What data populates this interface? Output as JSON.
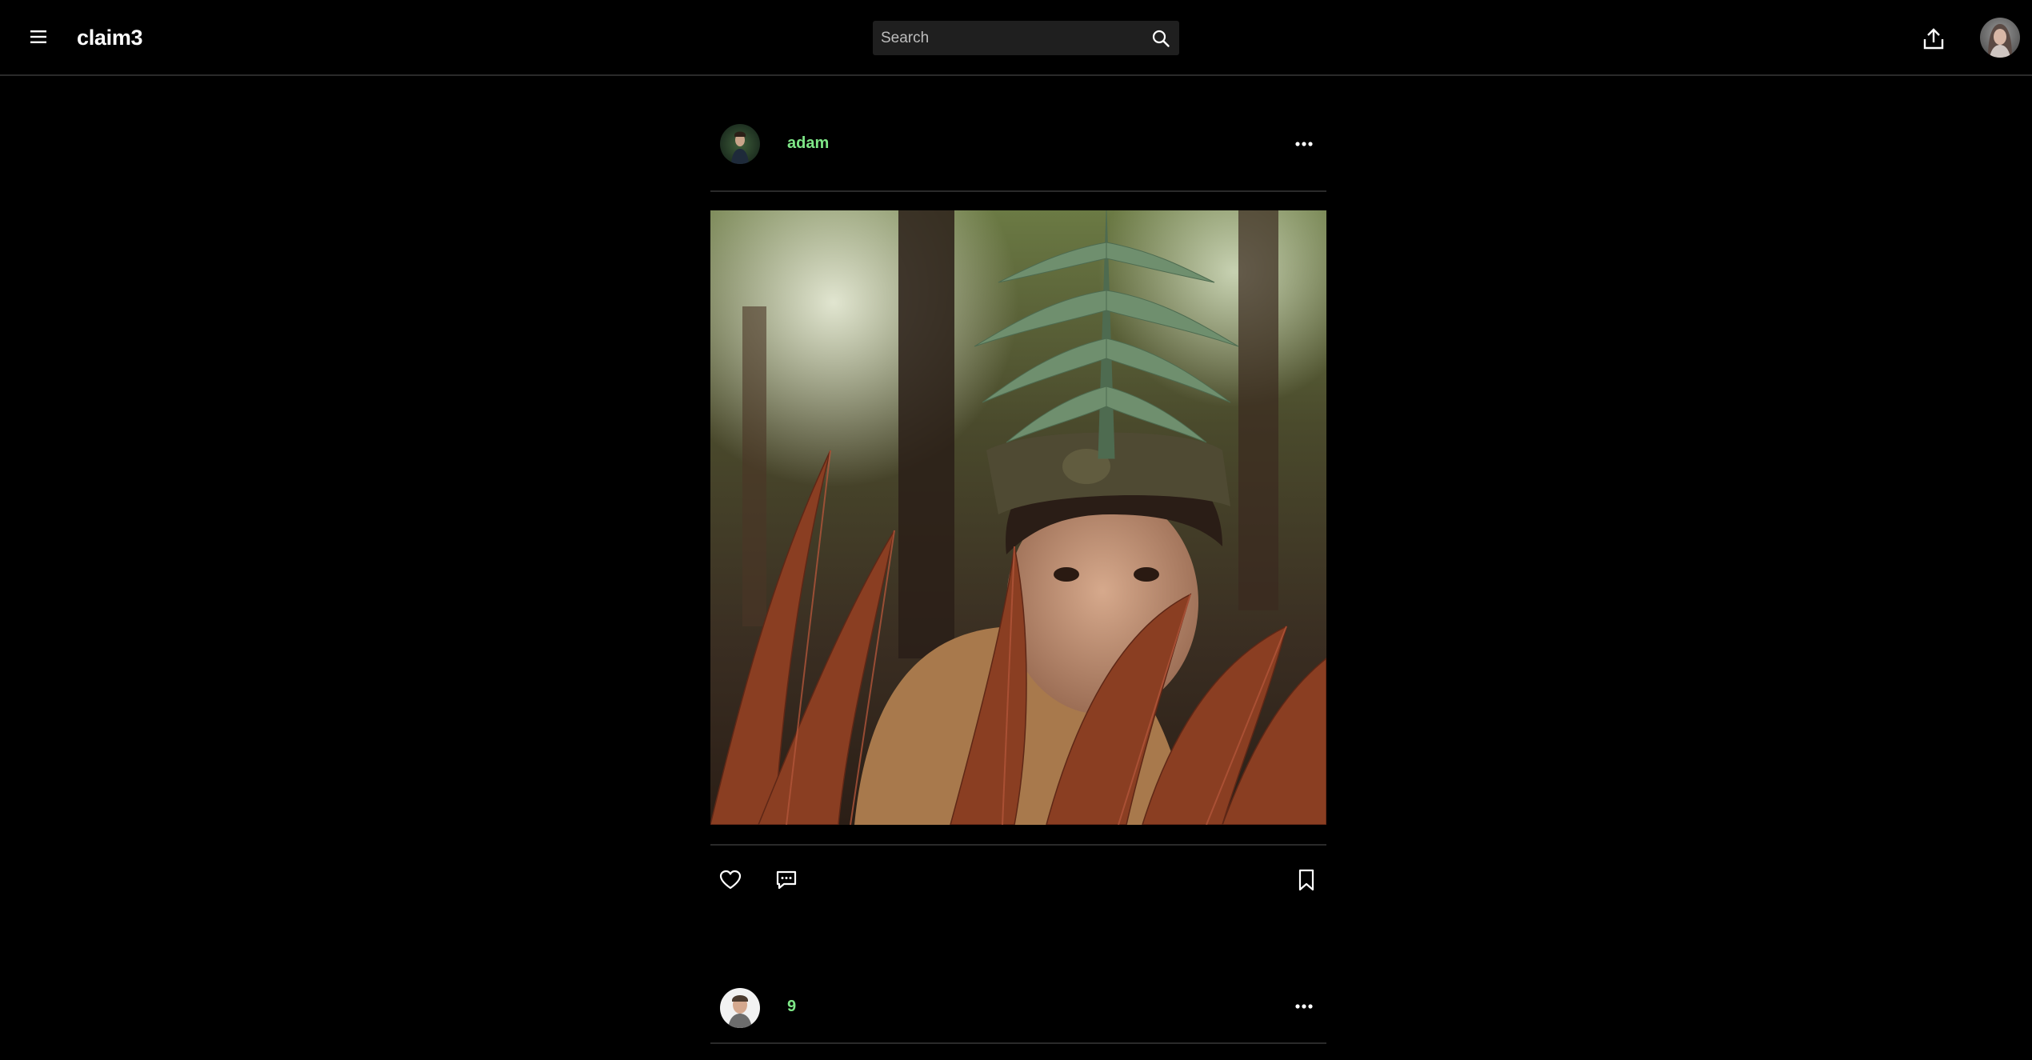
{
  "header": {
    "brand": "claim3",
    "search": {
      "placeholder": "Search",
      "value": ""
    },
    "menu_icon": "hamburger-icon",
    "search_icon": "search-icon",
    "upload_icon": "upload-icon"
  },
  "posts": [
    {
      "username": "adam",
      "username_color": "#7ee787",
      "more_icon": "more-horizontal-icon",
      "actions": {
        "like_icon": "heart-icon",
        "comment_icon": "comment-icon",
        "save_icon": "bookmark-icon"
      }
    },
    {
      "username": "9",
      "username_color": "#7ee787",
      "more_icon": "more-horizontal-icon"
    }
  ],
  "colors": {
    "background": "#000000",
    "divider": "#2a2a2a",
    "search_bg": "#1f1f1f",
    "username": "#7ee787"
  }
}
